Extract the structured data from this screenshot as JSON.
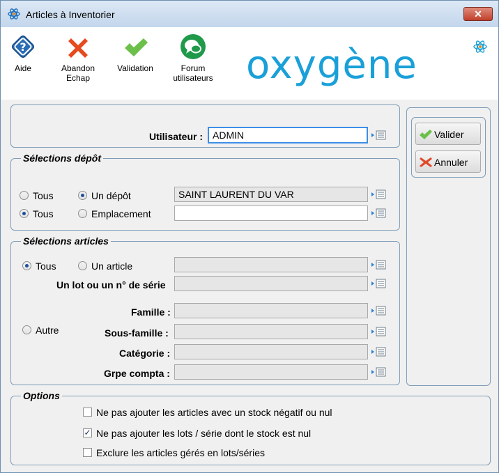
{
  "window": {
    "title": "Articles à Inventorier",
    "close_glyph": "✕"
  },
  "toolbar": {
    "help": {
      "label": "Aide",
      "icon": "help-diamond-icon"
    },
    "abort": {
      "label_line1": "Abandon",
      "label_line2": "Echap",
      "icon": "red-x-icon"
    },
    "validate": {
      "label": "Validation",
      "icon": "green-check-icon"
    },
    "forum": {
      "label_line1": "Forum",
      "label_line2": "utilisateurs",
      "icon": "chat-bubble-icon"
    },
    "logo": "oxygène"
  },
  "user": {
    "label": "Utilisateur :",
    "value": "ADMIN"
  },
  "depot": {
    "legend": "Sélections dépôt",
    "row1": {
      "all_label": "Tous",
      "all_selected": false,
      "option_label": "Un dépôt",
      "option_selected": true,
      "value": "SAINT LAURENT DU VAR"
    },
    "row2": {
      "all_label": "Tous",
      "all_selected": true,
      "option_label": "Emplacement",
      "option_selected": false,
      "value": ""
    }
  },
  "articles": {
    "legend": "Sélections articles",
    "all_label": "Tous",
    "all_selected": true,
    "one_label": "Un article",
    "one_selected": false,
    "lot_label": "Un lot ou un n° de série",
    "other_label": "Autre",
    "other_selected": false,
    "famille_label": "Famille :",
    "sous_famille_label": "Sous-famille :",
    "categorie_label": "Catégorie :",
    "grpe_compta_label": "Grpe compta :"
  },
  "options": {
    "legend": "Options",
    "items": [
      {
        "label": "Ne pas ajouter les articles avec un stock négatif ou nul",
        "checked": false
      },
      {
        "label": "Ne pas ajouter les lots / série dont le stock est nul",
        "checked": true
      },
      {
        "label": "Exclure les articles gérés en lots/séries",
        "checked": false
      }
    ]
  },
  "actions": {
    "validate_label": "Valider",
    "cancel_label": "Annuler"
  },
  "colors": {
    "accent": "#1aa0d8",
    "focus": "#3d8ee8",
    "check_green": "#6cc04a",
    "cancel_red": "#e04a2a"
  }
}
